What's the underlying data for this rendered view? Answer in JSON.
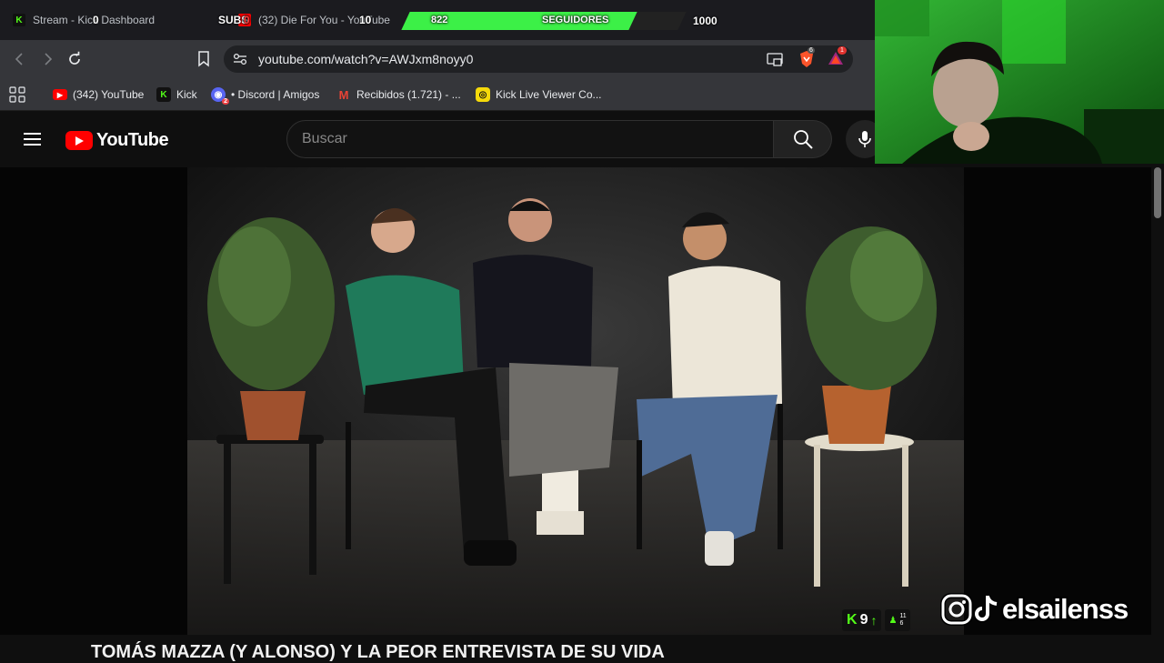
{
  "tabs": [
    {
      "label": "Stream - Kick Dashboard",
      "icon": "kick-icon"
    },
    {
      "label": "(32) Die For You - YouTube",
      "icon": "youtube-icon"
    }
  ],
  "overlay": {
    "counter_a": "0",
    "subs_label": "SUBS",
    "subs_count": "0",
    "counter_b": "10",
    "followers_current": "822",
    "followers_label": "SEGUIDORES",
    "followers_goal": "1000",
    "followers_progress": 0.822,
    "accent": "#3cf047"
  },
  "browser": {
    "url": "youtube.com/watch?v=AWJxm8noyy0",
    "brave_count": "6",
    "rewards_count": "1"
  },
  "bookmarks": [
    {
      "label": "(342) YouTube",
      "icon": "youtube-icon"
    },
    {
      "label": "Kick",
      "icon": "kick-icon"
    },
    {
      "label": "• Discord | Amigos",
      "icon": "discord-icon",
      "badge": "2"
    },
    {
      "label": "Recibidos (1.721) - ...",
      "icon": "gmail-icon"
    },
    {
      "label": "Kick Live Viewer Co...",
      "icon": "kick-viewer-icon"
    }
  ],
  "youtube": {
    "logo_text": "YouTube",
    "search_placeholder": "Buscar",
    "video_title": "TOMÁS MAZZA (Y ALONSO) Y LA PEOR ENTREVISTA DE SU VIDA"
  },
  "kick_badge": {
    "viewers": "9",
    "top": "11",
    "bottom": "6"
  },
  "social": {
    "handle": "elsailenss"
  },
  "colors": {
    "kick_green": "#53fc18",
    "youtube_red": "#ff0000"
  }
}
